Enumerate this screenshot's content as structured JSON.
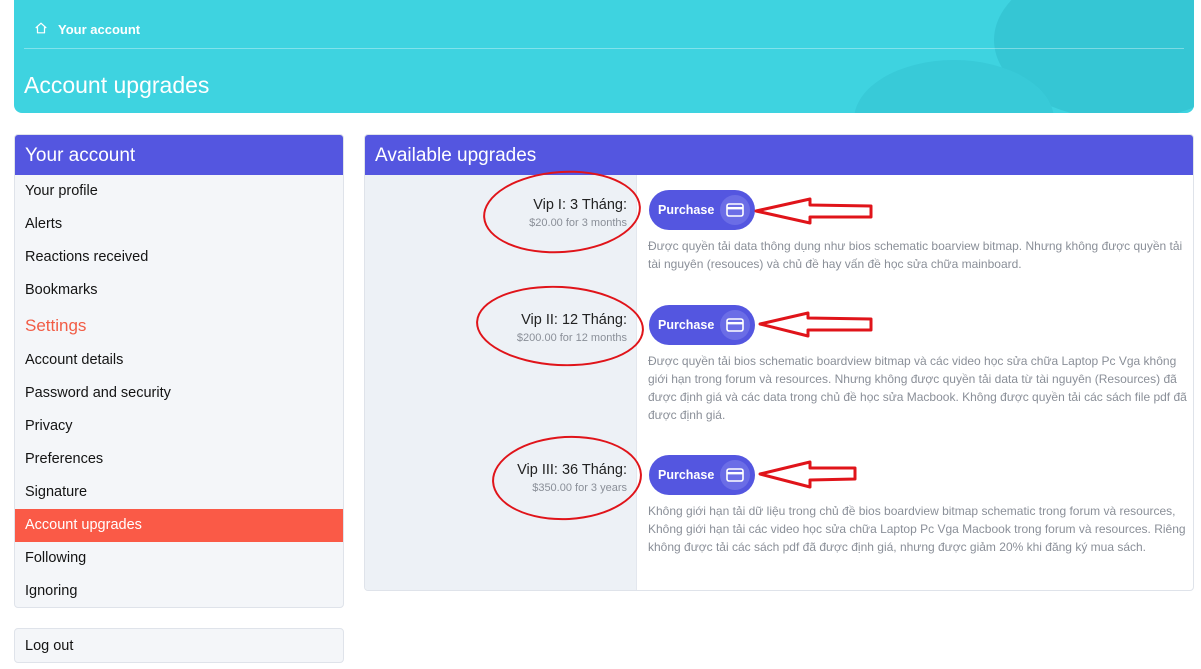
{
  "header": {
    "breadcrumb": "Your account",
    "title": "Account upgrades"
  },
  "sidebar": {
    "heading": "Your account",
    "items": [
      {
        "label": "Your profile"
      },
      {
        "label": "Alerts"
      },
      {
        "label": "Reactions received"
      },
      {
        "label": "Bookmarks"
      }
    ],
    "settings_heading": "Settings",
    "settings_items": [
      {
        "label": "Account details"
      },
      {
        "label": "Password and security"
      },
      {
        "label": "Privacy"
      },
      {
        "label": "Preferences"
      },
      {
        "label": "Signature"
      },
      {
        "label": "Account upgrades",
        "active": true
      },
      {
        "label": "Following"
      },
      {
        "label": "Ignoring"
      }
    ],
    "logout": "Log out"
  },
  "panel": {
    "heading": "Available upgrades",
    "purchase_label": "Purchase",
    "upgrades": [
      {
        "title": "Vip I: 3 Tháng:",
        "price": "$20.00 for 3 months",
        "description": "Được quyền tải data thông dụng như bios schematic boarview bitmap. Nhưng không được quyền tải tài nguyên (resouces) và chủ đề hay vấn đề học sửa chữa mainboard."
      },
      {
        "title": "Vip II: 12 Tháng:",
        "price": "$200.00 for 12 months",
        "description": "Được quyền tải bios schematic boardview bitmap và các video học sửa chữa Laptop Pc Vga không giới hạn trong forum và resources. Nhưng không được quyền tải data từ tài nguyên (Resources) đã được định giá và các data trong chủ đề học sửa Macbook. Không được quyền tải các sách file pdf đã được định giá."
      },
      {
        "title": "Vip III: 36 Tháng:",
        "price": "$350.00 for 3 years",
        "description": "Không giới hạn tải dữ liệu trong chủ đề bios boardview bitmap schematic trong forum và resources, Không giới hạn tải các video học sửa chữa Laptop Pc Vga Macbook trong forum và resources. Riêng không được tải các sách pdf đã được định giá, nhưng được giảm 20% khi đăng ký mua sách."
      }
    ]
  },
  "colors": {
    "header": "#3ed3e0",
    "accent": "#5456e0",
    "active": "#fa5a47",
    "annotation": "#e0141a"
  },
  "icons": {
    "breadcrumb": "home-icon",
    "purchase": "credit-card-icon"
  }
}
